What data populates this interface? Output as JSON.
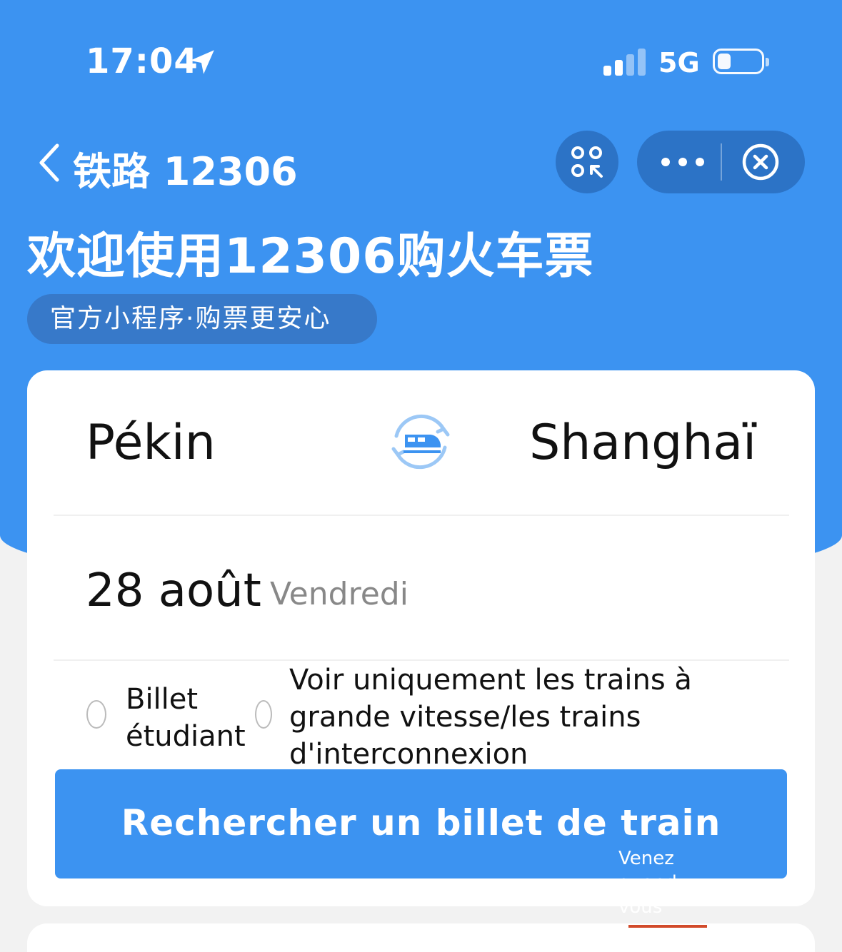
{
  "status_bar": {
    "time": "17:04",
    "network": "5G"
  },
  "nav": {
    "title": "铁路 12306"
  },
  "header": {
    "welcome": "欢迎使用12306购火车票",
    "tagline": "官方小程序·购票更安心"
  },
  "search_form": {
    "from_city": "Pékin",
    "to_city": "Shanghaï",
    "date": "28 août",
    "weekday": "Vendredi",
    "student_option_label": "Billet étudiant",
    "highspeed_option_label": "Voir uniquement les trains à grande vitesse/les trains d'interconnexion",
    "search_button_label": "Rechercher un billet de train"
  },
  "promo": {
    "text": "Venez quand vous"
  },
  "colors": {
    "brand_blue": "#3c93f1",
    "capsule_blue": "#2c73c6"
  },
  "icons": [
    "location-arrow-icon",
    "signal-icon",
    "battery-icon",
    "back-chevron-icon",
    "scan-icon",
    "more-icon",
    "close-circle-icon",
    "swap-train-icon"
  ]
}
